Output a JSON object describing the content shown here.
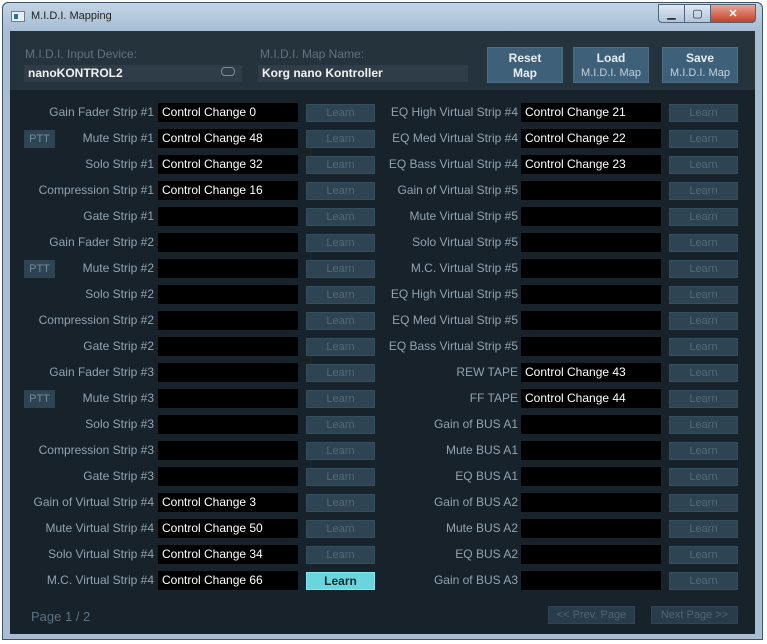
{
  "window": {
    "title": "M.I.D.I. Mapping",
    "controls": {
      "minimize": "▁",
      "maximize": "▢",
      "close": "✕"
    }
  },
  "header": {
    "input_device_label": "M.I.D.I. Input Device:",
    "input_device_value": "nanoKONTROL2",
    "map_name_label": "M.I.D.I. Map Name:",
    "map_name_value": "Korg nano Kontroller",
    "reset": {
      "line1": "Reset",
      "line2": "Map"
    },
    "load": {
      "line1": "Load",
      "line2": "M.I.D.I. Map"
    },
    "save": {
      "line1": "Save",
      "line2": "M.I.D.I. Map"
    }
  },
  "learn_label": "Learn",
  "ptt_label": "PTT",
  "left_rows": [
    {
      "label": "Gain Fader Strip #1",
      "value": "Control Change 0",
      "ptt": false,
      "active": false
    },
    {
      "label": "Mute Strip #1",
      "value": "Control Change 48",
      "ptt": true,
      "active": false
    },
    {
      "label": "Solo Strip #1",
      "value": "Control Change 32",
      "ptt": false,
      "active": false
    },
    {
      "label": "Compression Strip #1",
      "value": "Control Change 16",
      "ptt": false,
      "active": false
    },
    {
      "label": "Gate Strip #1",
      "value": "",
      "ptt": false,
      "active": false
    },
    {
      "label": "Gain Fader Strip #2",
      "value": "",
      "ptt": false,
      "active": false
    },
    {
      "label": "Mute Strip #2",
      "value": "",
      "ptt": true,
      "active": false
    },
    {
      "label": "Solo Strip #2",
      "value": "",
      "ptt": false,
      "active": false
    },
    {
      "label": "Compression Strip #2",
      "value": "",
      "ptt": false,
      "active": false
    },
    {
      "label": "Gate Strip #2",
      "value": "",
      "ptt": false,
      "active": false
    },
    {
      "label": "Gain Fader Strip #3",
      "value": "",
      "ptt": false,
      "active": false
    },
    {
      "label": "Mute Strip #3",
      "value": "",
      "ptt": true,
      "active": false
    },
    {
      "label": "Solo Strip #3",
      "value": "",
      "ptt": false,
      "active": false
    },
    {
      "label": "Compression Strip #3",
      "value": "",
      "ptt": false,
      "active": false
    },
    {
      "label": "Gate Strip #3",
      "value": "",
      "ptt": false,
      "active": false
    },
    {
      "label": "Gain of Virtual Strip #4",
      "value": "Control Change 3",
      "ptt": false,
      "active": false
    },
    {
      "label": "Mute Virtual Strip #4",
      "value": "Control Change 50",
      "ptt": false,
      "active": false
    },
    {
      "label": "Solo Virtual Strip #4",
      "value": "Control Change 34",
      "ptt": false,
      "active": false
    },
    {
      "label": "M.C. Virtual Strip #4",
      "value": "Control Change 66",
      "ptt": false,
      "active": true
    }
  ],
  "right_rows": [
    {
      "label": "EQ High Virtual Strip #4",
      "value": "Control Change 21"
    },
    {
      "label": "EQ Med Virtual Strip #4",
      "value": "Control Change 22"
    },
    {
      "label": "EQ Bass Virtual Strip #4",
      "value": "Control Change 23"
    },
    {
      "label": "Gain of Virtual Strip #5",
      "value": ""
    },
    {
      "label": "Mute Virtual Strip #5",
      "value": ""
    },
    {
      "label": "Solo Virtual Strip #5",
      "value": ""
    },
    {
      "label": "M.C. Virtual Strip #5",
      "value": ""
    },
    {
      "label": "EQ High Virtual Strip #5",
      "value": ""
    },
    {
      "label": "EQ Med Virtual Strip #5",
      "value": ""
    },
    {
      "label": "EQ Bass Virtual Strip #5",
      "value": ""
    },
    {
      "label": "REW TAPE",
      "value": "Control Change 43"
    },
    {
      "label": "FF TAPE",
      "value": "Control Change 44"
    },
    {
      "label": "Gain of BUS A1",
      "value": ""
    },
    {
      "label": "Mute BUS A1",
      "value": ""
    },
    {
      "label": "EQ BUS A1",
      "value": ""
    },
    {
      "label": "Gain of BUS A2",
      "value": ""
    },
    {
      "label": "Mute BUS A2",
      "value": ""
    },
    {
      "label": "EQ BUS A2",
      "value": ""
    },
    {
      "label": "Gain of BUS A3",
      "value": ""
    }
  ],
  "footer": {
    "page": "Page 1 / 2",
    "prev": "<< Prev. Page",
    "next": "Next Page >>"
  },
  "colors": {
    "learn_active": "#69d6de",
    "background": "#17222b"
  }
}
